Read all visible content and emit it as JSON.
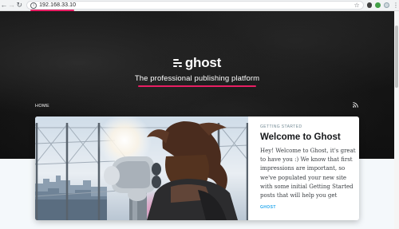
{
  "browser": {
    "url": "192.168.33.10",
    "icons": {
      "back": "arrow-left-icon",
      "forward": "arrow-right-icon",
      "reload": "reload-icon",
      "site_info": "info-icon",
      "bookmark": "star-icon",
      "menu": "kebab-menu-icon"
    }
  },
  "site": {
    "logo_text": "ghost",
    "tagline": "The professional publishing platform",
    "nav": [
      {
        "label": "HOME"
      }
    ],
    "rss_icon": "rss-icon"
  },
  "featured_post": {
    "tag": "GETTING STARTED",
    "title": "Welcome to Ghost",
    "excerpt": "Hey! Welcome to Ghost, it's great to have you :) We know that first impressions are important, so we've populated your new site with some initial Getting Started posts that will help you get",
    "author": "GHOST"
  },
  "colors": {
    "annotation_underline": "#e91e63",
    "author_link": "#26a8ed",
    "hero_bg": "#141414",
    "page_bg": "#f4f8fb"
  }
}
